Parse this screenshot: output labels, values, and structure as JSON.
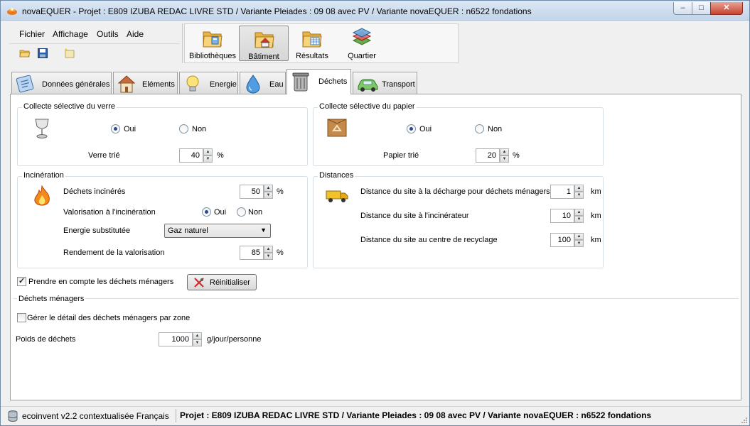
{
  "window": {
    "app_name": "novaEQUER",
    "title": "novaEQUER -  Projet : E809 IZUBA REDAC LIVRE STD / Variante Pleiades : 09 08 avec PV / Variante novaEQUER : n6522 fondations",
    "minimize": "–",
    "maximize": "□",
    "close": "✕"
  },
  "menu": {
    "items": [
      {
        "label": "Fichier"
      },
      {
        "label": "Affichage"
      },
      {
        "label": "Outils"
      },
      {
        "label": "Aide"
      }
    ]
  },
  "ribbon": {
    "buttons": [
      {
        "label": "Bibliothèques"
      },
      {
        "label": "Bâtiment"
      },
      {
        "label": "Résultats"
      },
      {
        "label": "Quartier"
      }
    ],
    "active": "Bâtiment"
  },
  "tabs": {
    "items": [
      {
        "label": "Données générales"
      },
      {
        "label": "Eléments"
      },
      {
        "label": "Energie"
      },
      {
        "label": "Eau"
      },
      {
        "label": "Déchets"
      },
      {
        "label": "Transport"
      }
    ],
    "active": "Déchets"
  },
  "verre": {
    "title": "Collecte sélective du verre",
    "oui": "Oui",
    "non": "Non",
    "selected": "Oui",
    "trie_label": "Verre trié",
    "trie_value": "40",
    "unit": "%"
  },
  "papier": {
    "title": "Collecte sélective du papier",
    "oui": "Oui",
    "non": "Non",
    "selected": "Oui",
    "trie_label": "Papier trié",
    "trie_value": "20",
    "unit": "%"
  },
  "incineration": {
    "title": "Incinération",
    "dechets_label": "Déchets incinérés",
    "dechets_value": "50",
    "dechets_unit": "%",
    "valorisation_label": "Valorisation à l'incinération",
    "oui": "Oui",
    "non": "Non",
    "selected": "Oui",
    "energie_label": "Energie substitutée",
    "energie_value": "Gaz naturel",
    "rendement_label": "Rendement de la valorisation",
    "rendement_value": "85",
    "rendement_unit": "%"
  },
  "distances": {
    "title": "Distances",
    "rows": [
      {
        "label": "Distance du site à la décharge pour déchets ménagers",
        "value": "1",
        "unit": "km"
      },
      {
        "label": "Distance du site à l'incinérateur",
        "value": "10",
        "unit": "km"
      },
      {
        "label": "Distance du site au centre de recyclage",
        "value": "100",
        "unit": "km"
      }
    ]
  },
  "menagers": {
    "checkbox_label": "Prendre en compte les déchets ménagers",
    "checked": true,
    "reset_label": "Réinitialiser",
    "section_title": "Déchets ménagers",
    "zone_label": "Gérer le détail des déchets ménagers par zone",
    "zone_checked": false,
    "poids_label": "Poids de déchets",
    "poids_value": "1000",
    "poids_unit": "g/jour/personne"
  },
  "status": {
    "database": "ecoinvent v2.2 contextualisée Français",
    "project": "Projet : E809 IZUBA REDAC LIVRE STD / Variante Pleiades : 09 08 avec PV / Variante novaEQUER : n6522 fondations"
  },
  "colors": {
    "accent": "#2a4a8a",
    "titlebar": "#c3d5ea",
    "close_button": "#c7432f"
  }
}
